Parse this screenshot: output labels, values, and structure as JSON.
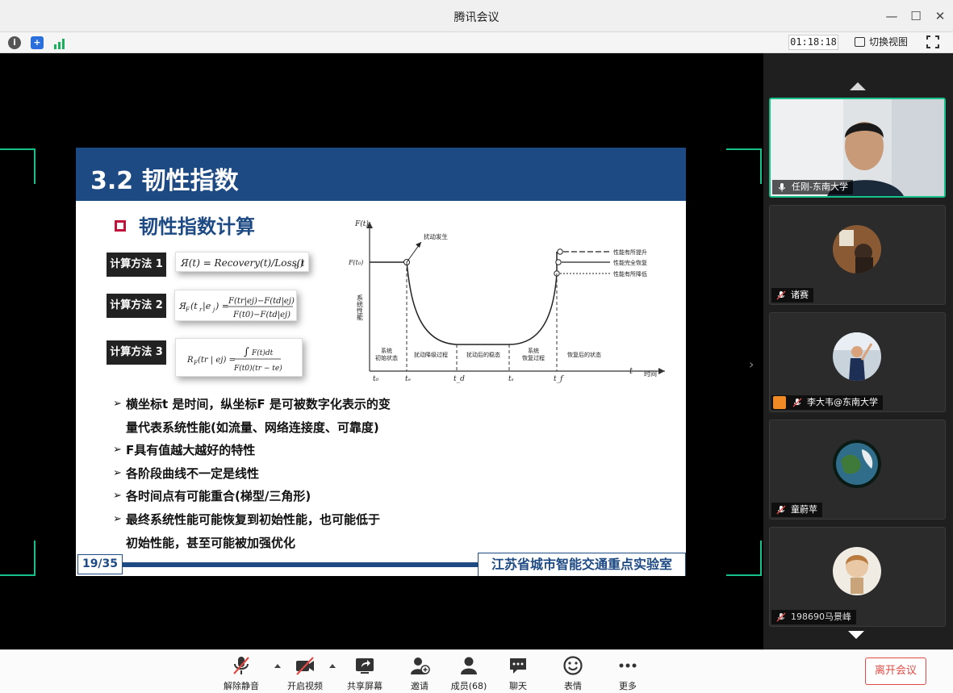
{
  "window": {
    "title": "腾讯会议"
  },
  "infobar": {
    "timer": "01:18:18",
    "switch_view_label": "切换视图"
  },
  "slide": {
    "title": "3.2 韧性指数",
    "subtitle": "韧性指数计算",
    "methods": [
      "计算方法 1",
      "计算方法 2",
      "计算方法 3"
    ],
    "bullets": [
      "横坐标t 是时间，纵坐标F 是可被数字化表示的变",
      "量代表系统性能(如流量、网络连接度、可靠度)",
      "F具有值越大越好的特性",
      "各阶段曲线不一定是线性",
      "各时间点有可能重合(梯型/三角形)",
      "最终系统性能可能恢复到初始性能，也可能低于",
      "初始性能，甚至可能被加强优化"
    ],
    "page": "19/35",
    "lab_name": "江苏省城市智能交通重点实验室",
    "figure": {
      "y_label": "F(t)",
      "y_tick": "F(t₀)",
      "y_axis_title": "系统性能",
      "x_label": "t",
      "x_axis_title": "时间",
      "x_ticks": [
        "t₀",
        "tₑ",
        "t_d",
        "tₛ",
        "t_f"
      ],
      "disturb": "扰动发生",
      "phases": [
        "系统\n初始状态",
        "扰动降级过程",
        "扰动后的稳态",
        "系统\n恢复过程",
        "恢复后的状态"
      ],
      "legend": [
        "性能有所提升",
        "性能完全恢复",
        "性能有所降低"
      ]
    }
  },
  "participants": [
    {
      "name": "任刚-东南大学",
      "active": true
    },
    {
      "name": "诸赛"
    },
    {
      "name": "李大韦@东南大学"
    },
    {
      "name": "童蔚苹"
    },
    {
      "name": "198690马景峰"
    }
  ],
  "toolbar": {
    "mute": "解除静音",
    "video": "开启视频",
    "share": "共享屏幕",
    "invite": "邀请",
    "members": "成员(68)",
    "chat": "聊天",
    "emoji": "表情",
    "more": "更多",
    "leave": "离开会议"
  },
  "colors": {
    "accent": "#16c28a",
    "slide_blue": "#1e4a84",
    "leave_red": "#e14a44"
  }
}
